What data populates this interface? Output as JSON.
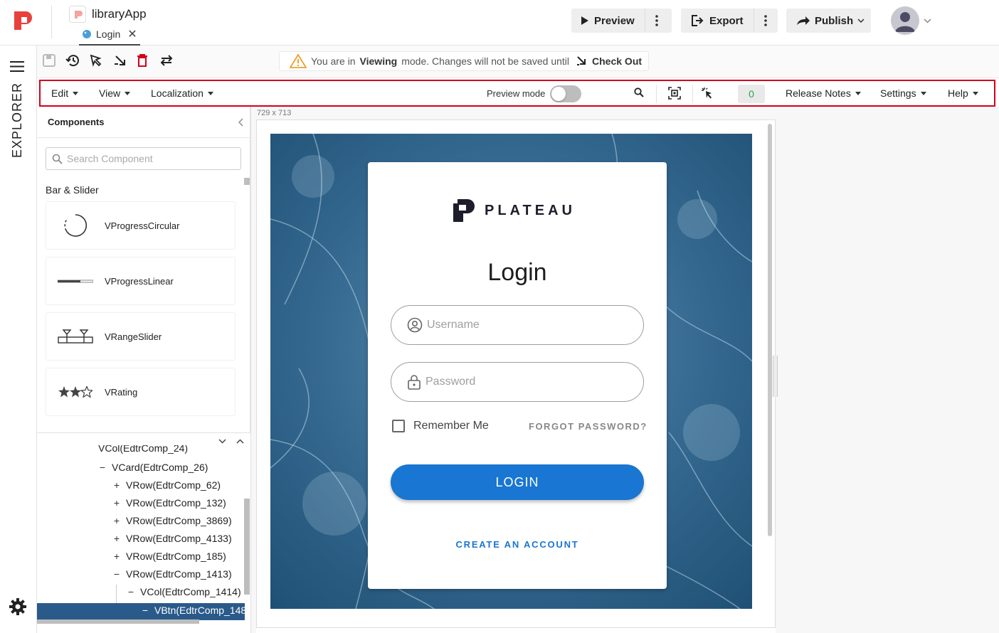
{
  "header": {
    "app_name": "libraryApp",
    "page_tab": "Login",
    "preview_label": "Preview",
    "export_label": "Export",
    "publish_label": "Publish"
  },
  "rail": {
    "label": "EXPLORER"
  },
  "banner": {
    "prefix": "You are in",
    "mode": "Viewing",
    "suffix": "mode. Changes will not be saved until",
    "checkout_label": "Check Out"
  },
  "menubar": {
    "edit": "Edit",
    "view": "View",
    "localization": "Localization",
    "preview_mode": "Preview mode",
    "counter": "0",
    "release_notes": "Release Notes",
    "settings": "Settings",
    "help": "Help"
  },
  "components_panel": {
    "title": "Components",
    "search_placeholder": "Search Component",
    "category": "Bar & Slider",
    "items": [
      {
        "label": "VProgressCircular",
        "icon": "progress-circular-icon"
      },
      {
        "label": "VProgressLinear",
        "icon": "progress-linear-icon"
      },
      {
        "label": "VRangeSlider",
        "icon": "range-slider-icon"
      },
      {
        "label": "VRating",
        "icon": "rating-icon"
      }
    ]
  },
  "tree": {
    "rows": [
      {
        "sym": "",
        "label": "VCol(EdtrComp_24)"
      },
      {
        "sym": "−",
        "label": "VCard(EdtrComp_26)"
      },
      {
        "sym": "+",
        "label": "VRow(EdtrComp_62)"
      },
      {
        "sym": "+",
        "label": "VRow(EdtrComp_132)"
      },
      {
        "sym": "+",
        "label": "VRow(EdtrComp_3869)"
      },
      {
        "sym": "+",
        "label": "VRow(EdtrComp_4133)"
      },
      {
        "sym": "+",
        "label": "VRow(EdtrComp_185)"
      },
      {
        "sym": "−",
        "label": "VRow(EdtrComp_1413)"
      },
      {
        "sym": "−",
        "label": "VCol(EdtrComp_1414)"
      },
      {
        "sym": "−",
        "label": "VBtn(EdtrComp_148"
      }
    ]
  },
  "canvas": {
    "size_label": "729 x 713"
  },
  "login": {
    "brand": "PLATEAU",
    "title": "Login",
    "username_placeholder": "Username",
    "password_placeholder": "Password",
    "remember_label": "Remember Me",
    "forgot_label": "FORGOT PASSWORD?",
    "login_button": "LOGIN",
    "create_account": "CREATE AN ACCOUNT"
  },
  "colors": {
    "accent": "#1976d2",
    "brand_red": "#e8413c",
    "highlight_border": "#d0021b",
    "tree_selected": "#2a5a8a",
    "counter_green": "#27a844"
  }
}
